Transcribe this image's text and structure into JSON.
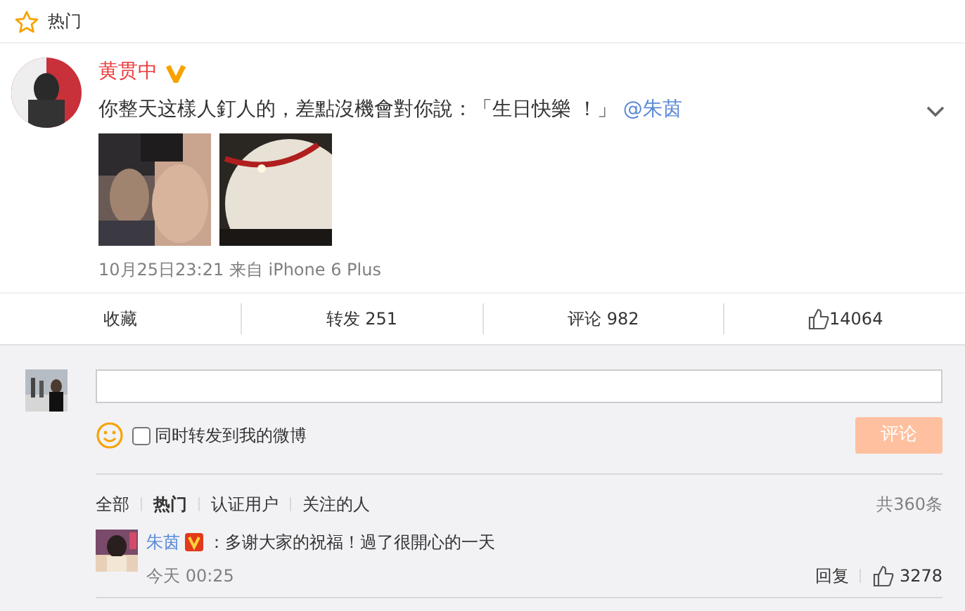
{
  "header": {
    "title": "热门"
  },
  "post": {
    "author": "黄贯中",
    "verified": true,
    "text": "你整天这樣人釘人的，差點沒機會對你說：「生日快樂 ！」",
    "mention": "@朱茵",
    "meta": "10月25日23:21 来自 iPhone 6 Plus"
  },
  "actions": [
    {
      "label": "收藏",
      "kind": "text"
    },
    {
      "label": "转发 251",
      "kind": "text"
    },
    {
      "label": "评论 982",
      "kind": "text"
    },
    {
      "label": "14064",
      "kind": "like"
    }
  ],
  "composer": {
    "repost_label": "同时转发到我的微博",
    "repost_checked": false,
    "submit": "评论",
    "submit_disabled": true
  },
  "comment_filters": [
    {
      "label": "全部",
      "selected": false
    },
    {
      "label": "热门",
      "selected": true
    },
    {
      "label": "认证用户",
      "selected": false
    },
    {
      "label": "关注的人",
      "selected": false
    }
  ],
  "comment_count": "共360条",
  "comments": [
    {
      "author": "朱茵",
      "verified": true,
      "text": "：多谢大家的祝福！過了很開心的一天",
      "time": "今天 00:25",
      "reply": "回复",
      "likes": "3278"
    }
  ]
}
